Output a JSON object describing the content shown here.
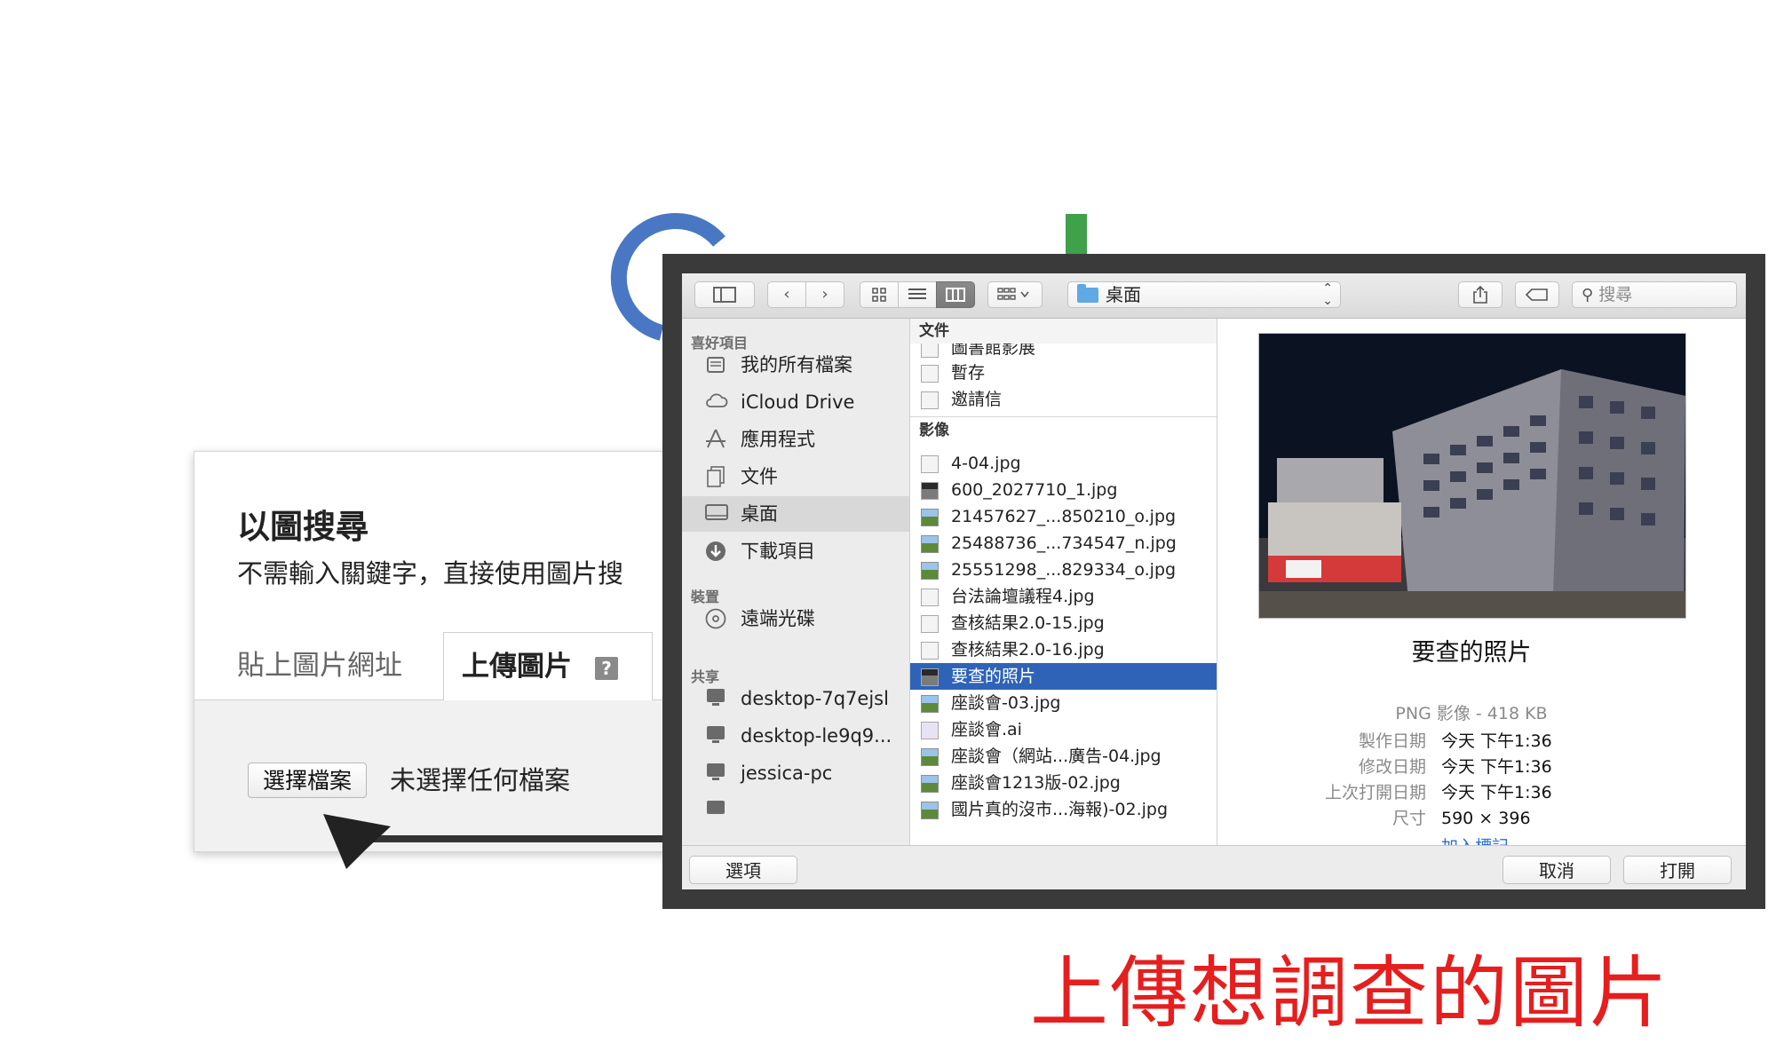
{
  "colors": {
    "google_blue": "#4a77c4",
    "google_green": "#3fa14a",
    "selection": "#2e63b8",
    "caption_red": "#e61e1e",
    "link_blue": "#2b6fd6"
  },
  "search_by_image": {
    "title": "以圖搜尋",
    "subtitle": "不需輸入關鍵字，直接使用圖片搜",
    "tabs": [
      {
        "label": "貼上圖片網址"
      },
      {
        "label": "上傳圖片",
        "help_icon": "?"
      }
    ],
    "choose_file_label": "選擇檔案",
    "no_file_text": "未選擇任何檔案"
  },
  "dialog": {
    "toolbar": {
      "path_label": "桌面",
      "search_placeholder": "搜尋",
      "icons": [
        "sidebar-toggle-icon",
        "back-icon",
        "forward-icon",
        "icon-view-icon",
        "list-view-icon",
        "column-view-icon",
        "group-icon",
        "share-icon",
        "tag-icon",
        "search-icon"
      ]
    },
    "sidebar": {
      "favorites_heading": "喜好項目",
      "favorites": [
        {
          "label": "我的所有檔案",
          "icon": "all-files-icon"
        },
        {
          "label": "iCloud Drive",
          "icon": "cloud-icon"
        },
        {
          "label": "應用程式",
          "icon": "applications-icon"
        },
        {
          "label": "文件",
          "icon": "documents-icon"
        },
        {
          "label": "桌面",
          "icon": "desktop-icon"
        },
        {
          "label": "下載項目",
          "icon": "download-icon"
        }
      ],
      "devices_heading": "裝置",
      "devices": [
        {
          "label": "遠端光碟",
          "icon": "disc-icon"
        }
      ],
      "shared_heading": "共享",
      "shared": [
        {
          "label": "desktop-7q7ejsl",
          "icon": "computer-icon"
        },
        {
          "label": "desktop-le9q9...",
          "icon": "computer-icon"
        },
        {
          "label": "jessica-pc",
          "icon": "computer-icon"
        }
      ]
    },
    "file_column": {
      "documents_heading": "文件",
      "documents": [
        "圖書館影展",
        "暫存",
        "邀請信"
      ],
      "images_heading": "影像",
      "images": [
        "4-04.jpg",
        "600_2027710_1.jpg",
        "21457627_...850210_o.jpg",
        "25488736_...734547_n.jpg",
        "25551298_...829334_o.jpg",
        "台法論壇議程4.jpg",
        "查核結果2.0-15.jpg",
        "查核結果2.0-16.jpg",
        "要查的照片",
        "座談會-03.jpg",
        "座談會.ai",
        "座談會（網站...廣告-04.jpg",
        "座談會1213版-02.jpg",
        "國片真的沒市...海報)-02.jpg"
      ],
      "selected_index": 8
    },
    "preview": {
      "name": "要查的照片",
      "kind": "PNG 影像 - 418 KB",
      "meta": [
        {
          "key": "製作日期",
          "value": "今天 下午1:36"
        },
        {
          "key": "修改日期",
          "value": "今天 下午1:36"
        },
        {
          "key": "上次打開日期",
          "value": "今天 下午1:36"
        },
        {
          "key": "尺寸",
          "value": "590 × 396"
        }
      ],
      "add_tag": "加入標記..."
    },
    "footer": {
      "options_label": "選項",
      "cancel_label": "取消",
      "open_label": "打開"
    }
  },
  "caption": "上傳想調查的圖片"
}
